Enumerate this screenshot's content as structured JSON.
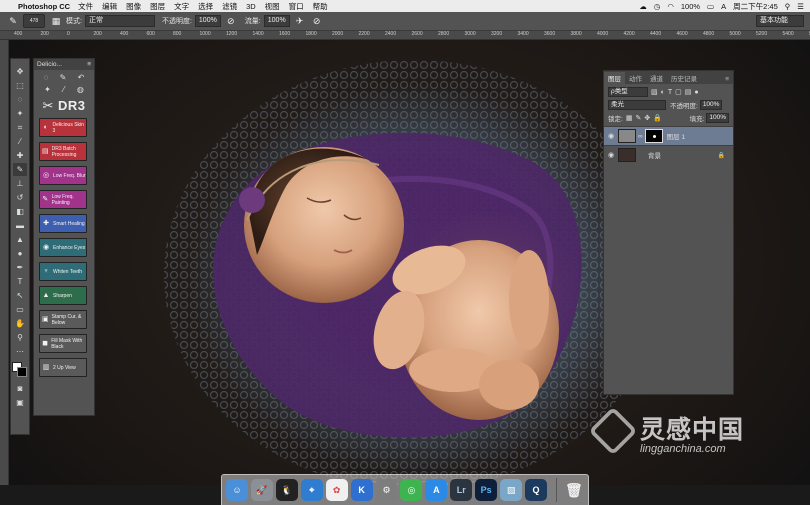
{
  "menubar": {
    "app_name": "Photoshop CC",
    "items": [
      "文件",
      "编辑",
      "图像",
      "图层",
      "文字",
      "选择",
      "滤镜",
      "3D",
      "视图",
      "窗口",
      "帮助"
    ],
    "battery": "100%",
    "clock": "周二下午2:45"
  },
  "options": {
    "brush_size": "478",
    "mode_label": "模式:",
    "mode_value": "正常",
    "opacity_label": "不透明度:",
    "opacity_value": "100%",
    "flow_label": "流量:",
    "flow_value": "100%",
    "workspace": "基本功能"
  },
  "ruler_ticks": [
    "400",
    "200",
    "0",
    "200",
    "400",
    "600",
    "800",
    "1000",
    "1200",
    "1400",
    "1600",
    "1800",
    "2000",
    "2200",
    "2400",
    "2600",
    "2800",
    "3000",
    "3200",
    "3400",
    "3600",
    "3800",
    "4000",
    "4200",
    "4400",
    "4600",
    "4800",
    "5000",
    "5200",
    "5400",
    "5600",
    "5800"
  ],
  "extension": {
    "title": "Delicio...",
    "logo": "DR3",
    "buttons": [
      {
        "label": "Delicious Skin 3",
        "color": "red"
      },
      {
        "label": "DR3 Batch Processing",
        "color": "red"
      },
      {
        "label": "Low Freq. Blur",
        "color": "pink"
      },
      {
        "label": "Low Freq. Painting",
        "color": "pink"
      },
      {
        "label": "Smart Healing",
        "color": "blue"
      },
      {
        "label": "Enhance Eyes",
        "color": "teal"
      },
      {
        "label": "Whiten Teeth",
        "color": "teal"
      },
      {
        "label": "Sharpen",
        "color": "green"
      },
      {
        "label": "Stamp Cur. & Below",
        "color": "gray"
      },
      {
        "label": "Fill Mask With Black",
        "color": "gray"
      },
      {
        "label": "2 Up View",
        "color": "gray"
      }
    ]
  },
  "layers": {
    "tabs": [
      "图层",
      "动作",
      "通道",
      "历史记录"
    ],
    "kind": "ρ类型",
    "blend": "柔光",
    "opacity_label": "不透明度:",
    "opacity_value": "100%",
    "lock_label": "锁定:",
    "fill_label": "填充:",
    "fill_value": "100%",
    "rows": [
      {
        "name": "图层 1",
        "selected": true
      },
      {
        "name": "背景",
        "selected": false
      }
    ]
  },
  "watermark": {
    "cn": "灵感中国",
    "en": "lingganchina.com"
  },
  "colors": {
    "accent_layer": "#6d7c92"
  }
}
